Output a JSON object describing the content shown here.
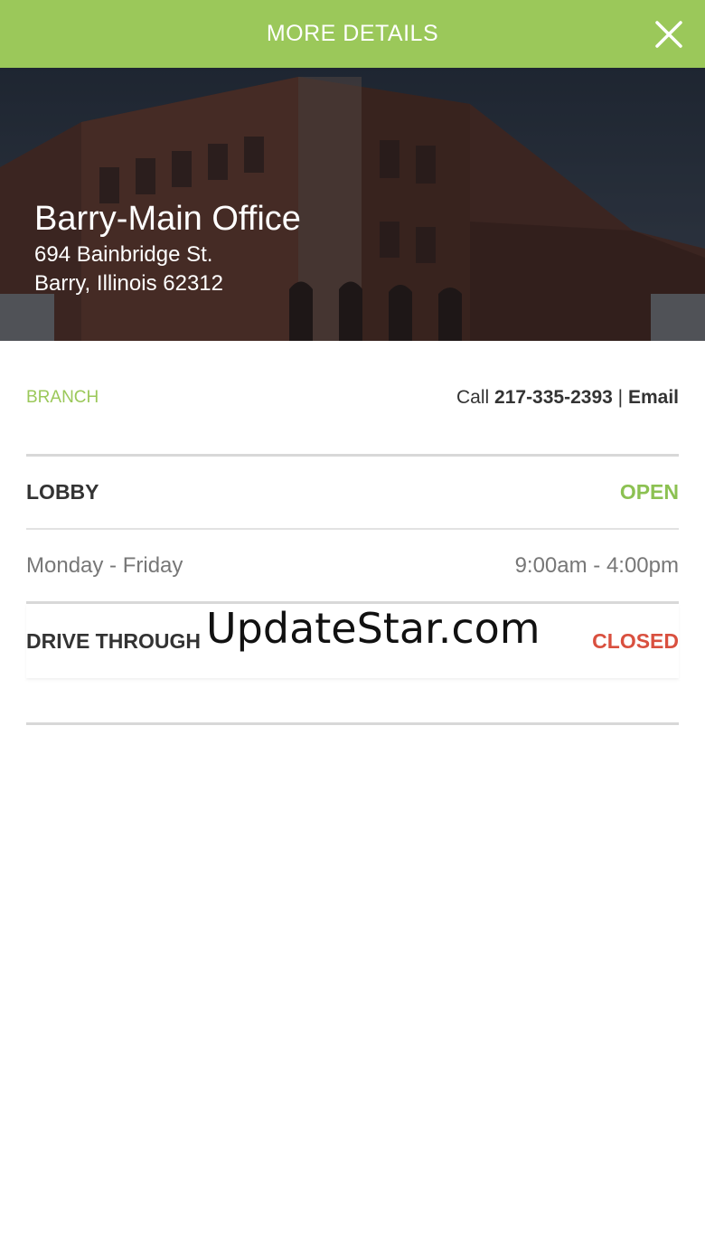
{
  "header": {
    "title": "MORE DETAILS",
    "close_icon": "close-icon"
  },
  "branch": {
    "name": "Barry-Main Office",
    "address_line1": "694 Bainbridge St.",
    "address_line2": "Barry, Illinois 62312",
    "type_label": "BRANCH",
    "call_prefix": "Call",
    "phone": "217-335-2393",
    "separator": "|",
    "email_label": "Email"
  },
  "hours": {
    "lobby": {
      "title": "LOBBY",
      "status": "OPEN",
      "days": "Monday - Friday",
      "time": "9:00am - 4:00pm"
    },
    "drive_through": {
      "title": "DRIVE THROUGH",
      "status": "CLOSED"
    }
  },
  "watermark": "UpdateStar.com",
  "colors": {
    "accent": "#9bc85a",
    "open": "#8cc152",
    "closed": "#d9503f"
  }
}
